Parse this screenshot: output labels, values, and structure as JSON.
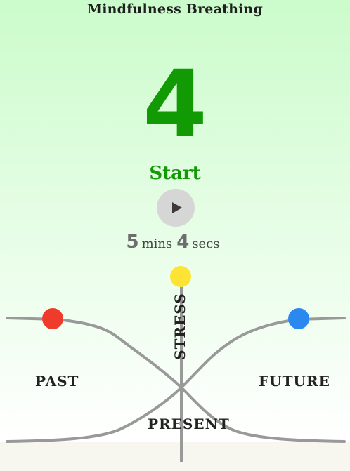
{
  "app": {
    "title": "Mindfulness Breathing"
  },
  "breath": {
    "count": "4",
    "action_label": "Start"
  },
  "controls": {
    "play_icon": "play-icon"
  },
  "duration": {
    "minutes": "5",
    "minutes_unit": "mins",
    "seconds": "4",
    "seconds_unit": "secs"
  },
  "diagram": {
    "labels": {
      "past": "PAST",
      "future": "FUTURE",
      "present": "PRESENT",
      "stress": "STRESS"
    },
    "colors": {
      "past_dot": "#ef3b2c",
      "stress_dot": "#fde434",
      "future_dot": "#2a88ee",
      "lines": "#999999",
      "accent_green": "#129a05"
    }
  }
}
